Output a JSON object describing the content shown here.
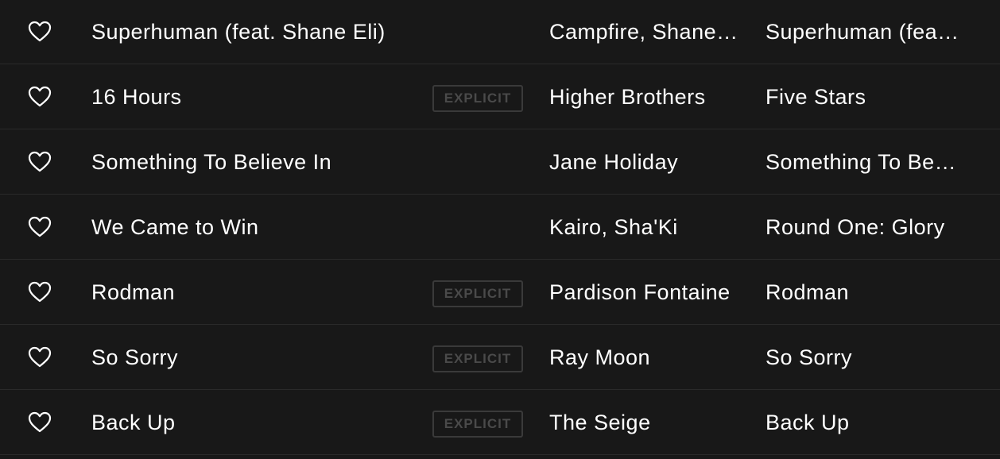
{
  "tracks": [
    {
      "title": "Superhuman (feat. Shane Eli)",
      "explicit": false,
      "artist": "Campfire, Shane Eli",
      "album": "Superhuman (feat. Shane Eli)"
    },
    {
      "title": "16 Hours",
      "explicit": true,
      "artist": "Higher Brothers",
      "album": "Five Stars"
    },
    {
      "title": "Something To Believe In",
      "explicit": false,
      "artist": "Jane Holiday",
      "album": "Something To Believe In"
    },
    {
      "title": "We Came to Win",
      "explicit": false,
      "artist": "Kairo, Sha'Ki",
      "album": "Round One: Glory"
    },
    {
      "title": "Rodman",
      "explicit": true,
      "artist": "Pardison Fontaine",
      "album": "Rodman"
    },
    {
      "title": "So Sorry",
      "explicit": true,
      "artist": "Ray Moon",
      "album": "So Sorry"
    },
    {
      "title": "Back Up",
      "explicit": true,
      "artist": "The Seige",
      "album": "Back Up"
    }
  ],
  "explicit_label": "EXPLICIT",
  "heart_icon": "heart-outline-icon",
  "colors": {
    "background": "#181818",
    "divider": "#2a2a2a",
    "text": "#ffffff",
    "explicit_badge": "#3a3a3a"
  }
}
